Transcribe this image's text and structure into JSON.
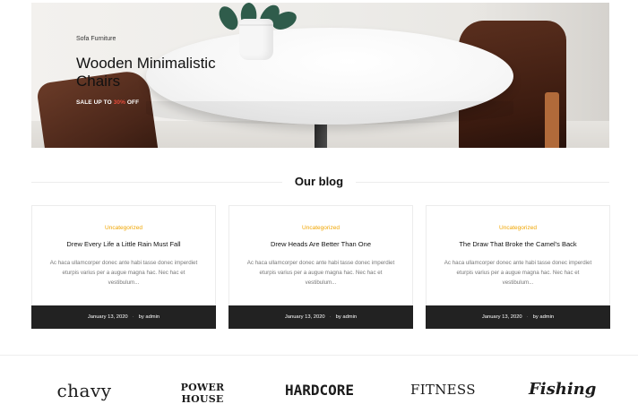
{
  "hero": {
    "subtitle": "Sofa Furniture",
    "title_line1": "Wooden Minimalistic",
    "title_line2": "Chairs",
    "sale_prefix": "SALE UP TO ",
    "sale_value": "30%",
    "sale_suffix": " OFF",
    "accent_color": "#e74c3c"
  },
  "blog": {
    "heading": "Our blog",
    "posts": [
      {
        "category": "Uncategorized",
        "title": "Drew Every Life a Little Rain Must Fall",
        "excerpt": "Ac haca ullamcorper donec ante habi tasse donec imperdiet eturpis varius per a augue magna hac. Nec hac et vestibulum...",
        "date": "January 13, 2020",
        "author": "by admin"
      },
      {
        "category": "Uncategorized",
        "title": "Drew Heads Are Better Than One",
        "excerpt": "Ac haca ullamcorper donec ante habi tasse donec imperdiet eturpis varius per a augue magna hac. Nec hac et vestibulum...",
        "date": "January 13, 2020",
        "author": "by admin"
      },
      {
        "category": "Uncategorized",
        "title": "The Draw That Broke the Camel's Back",
        "excerpt": "Ac haca ullamcorper donec ante habi tasse donec imperdiet eturpis varius per a augue magna hac. Nec hac et vestibulum...",
        "date": "January 13, 2020",
        "author": "by admin"
      }
    ],
    "category_color": "#f0a500",
    "meta_bg_color": "#222222"
  },
  "brands": [
    "chavy",
    "POWER HOUSE",
    "HARDCORE",
    "FITNESS",
    "Fishing"
  ]
}
